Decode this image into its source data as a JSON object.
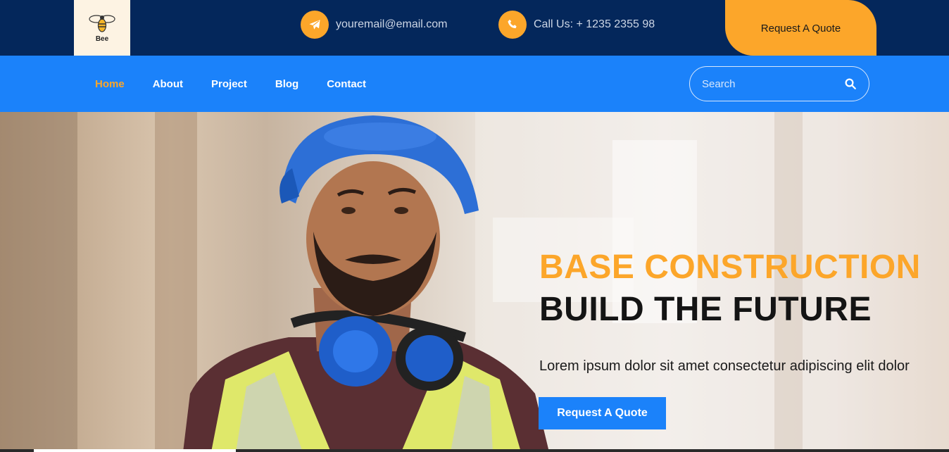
{
  "brand": {
    "name": "Bee",
    "icon": "bee-icon"
  },
  "topbar": {
    "email": {
      "icon": "paper-plane-icon",
      "text": "youremail@email.com"
    },
    "phone": {
      "icon": "phone-icon",
      "text": "Call Us: + 1235 2355 98"
    },
    "quote_label": "Request A Quote"
  },
  "nav": {
    "items": [
      {
        "label": "Home",
        "active": true
      },
      {
        "label": "About",
        "active": false
      },
      {
        "label": "Project",
        "active": false
      },
      {
        "label": "Blog",
        "active": false
      },
      {
        "label": "Contact",
        "active": false
      }
    ],
    "search": {
      "placeholder": "Search",
      "icon": "search-icon"
    }
  },
  "hero": {
    "title": "BASE CONSTRUCTION",
    "subtitle": "BUILD THE FUTURE",
    "text": "Lorem ipsum dolor sit amet consectetur adipiscing elit dolor",
    "button_label": "Request A Quote"
  },
  "colors": {
    "navy": "#04275b",
    "blue": "#1b82fa",
    "orange": "#fca62a"
  }
}
